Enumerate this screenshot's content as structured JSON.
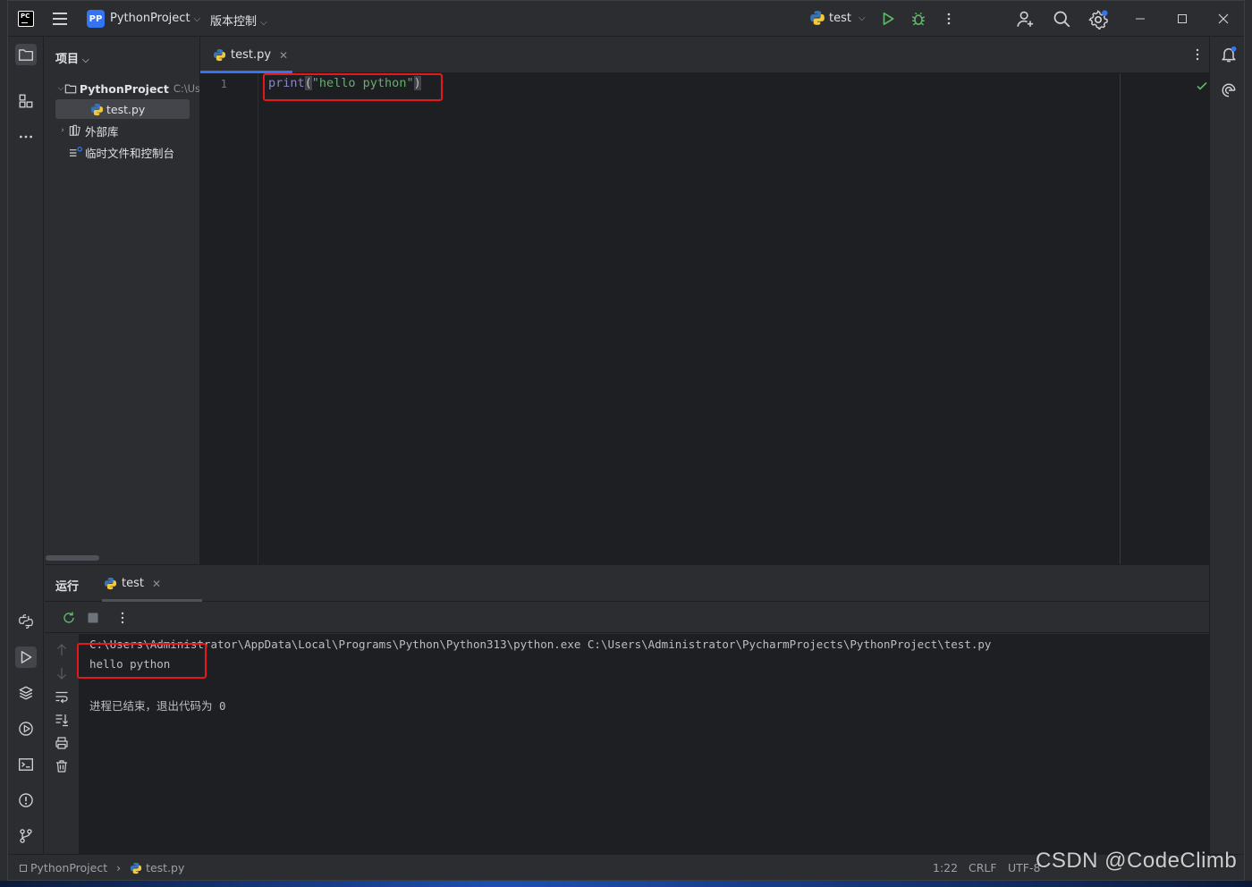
{
  "titlebar": {
    "project_badge": "PP",
    "project_name": "PythonProject",
    "vcs_menu": "版本控制",
    "run_config": "test"
  },
  "project_panel": {
    "header": "项目",
    "root_name": "PythonProject",
    "root_path": "C:\\Us",
    "file": "test.py",
    "external_libs": "外部库",
    "scratches": "临时文件和控制台"
  },
  "editor": {
    "tab_label": "test.py",
    "line_number": "1",
    "code": {
      "fn": "print",
      "open": "(",
      "str": "\"hello python\"",
      "close": ")"
    }
  },
  "run_panel": {
    "title": "运行",
    "tab_label": "test",
    "console": [
      "C:\\Users\\Administrator\\AppData\\Local\\Programs\\Python\\Python313\\python.exe C:\\Users\\Administrator\\PycharmProjects\\PythonProject\\test.py",
      "hello python",
      "",
      "进程已结束，退出代码为 0"
    ]
  },
  "statusbar": {
    "project": "PythonProject",
    "file": "test.py",
    "position": "1:22",
    "line_sep": "CRLF",
    "encoding": "UTF-8"
  },
  "watermark": "CSDN @CodeClimb",
  "colors": {
    "accent": "#3574f0",
    "run_green": "#5fb865",
    "highlight_red": "#e5181b"
  }
}
